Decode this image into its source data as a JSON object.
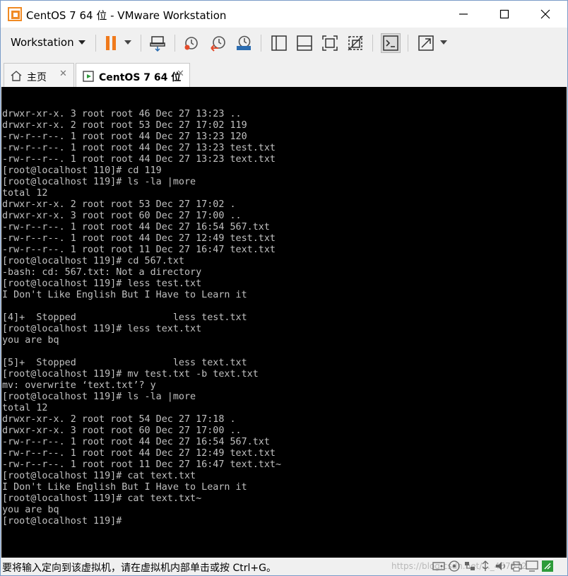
{
  "window": {
    "title": "CentOS 7 64 位 - VMware Workstation",
    "minimize_glyph": "—",
    "maximize_glyph": "☐",
    "close_glyph": "✕"
  },
  "toolbar": {
    "menu_label": "Workstation",
    "icons": [
      "pause-icon",
      "send-keys-icon",
      "snapshot-icon",
      "revert-snapshot-icon",
      "snapshot-manager-icon",
      "library-icon",
      "thumbnail-icon",
      "fullscreen-icon",
      "unity-icon",
      "console-view-icon",
      "stretch-icon"
    ]
  },
  "tabs": [
    {
      "label": "主页",
      "close": "✕",
      "icon": "home-icon"
    },
    {
      "label": "CentOS 7 64 位",
      "close": "✕",
      "icon": "vm-icon"
    }
  ],
  "console": {
    "lines": [
      "drwxr-xr-x. 3 root root 46 Dec 27 13:23 ..",
      "drwxr-xr-x. 2 root root 53 Dec 27 17:02 119",
      "-rw-r--r--. 1 root root 44 Dec 27 13:23 120",
      "-rw-r--r--. 1 root root 44 Dec 27 13:23 test.txt",
      "-rw-r--r--. 1 root root 44 Dec 27 13:23 text.txt",
      "[root@localhost 110]# cd 119",
      "[root@localhost 119]# ls -la |more",
      "total 12",
      "drwxr-xr-x. 2 root root 53 Dec 27 17:02 .",
      "drwxr-xr-x. 3 root root 60 Dec 27 17:00 ..",
      "-rw-r--r--. 1 root root 44 Dec 27 16:54 567.txt",
      "-rw-r--r--. 1 root root 44 Dec 27 12:49 test.txt",
      "-rw-r--r--. 1 root root 11 Dec 27 16:47 text.txt",
      "[root@localhost 119]# cd 567.txt",
      "-bash: cd: 567.txt: Not a directory",
      "[root@localhost 119]# less test.txt",
      "I Don't Like English But I Have to Learn it",
      "",
      "[4]+  Stopped                 less test.txt",
      "[root@localhost 119]# less text.txt",
      "you are bq",
      "",
      "[5]+  Stopped                 less text.txt",
      "[root@localhost 119]# mv test.txt -b text.txt",
      "mv: overwrite ‘text.txt’? y",
      "[root@localhost 119]# ls -la |more",
      "total 12",
      "drwxr-xr-x. 2 root root 54 Dec 27 17:18 .",
      "drwxr-xr-x. 3 root root 60 Dec 27 17:00 ..",
      "-rw-r--r--. 1 root root 44 Dec 27 16:54 567.txt",
      "-rw-r--r--. 1 root root 44 Dec 27 12:49 text.txt",
      "-rw-r--r--. 1 root root 11 Dec 27 16:47 text.txt~",
      "[root@localhost 119]# cat text.txt",
      "I Don't Like English But I Have to Learn it",
      "[root@localhost 119]# cat text.txt~",
      "you are bq",
      "[root@localhost 119]#"
    ]
  },
  "statusbar": {
    "text": "要将输入定向到该虚拟机，请在虚拟机内部单击或按 Ctrl+G。",
    "watermark": "https://blog.csdn.net/..._457872"
  },
  "colors": {
    "accent_orange": "#f07a1c",
    "icon_blue": "#2b6cb0",
    "console_bg": "#000000",
    "console_fg": "#c0c0c0"
  }
}
